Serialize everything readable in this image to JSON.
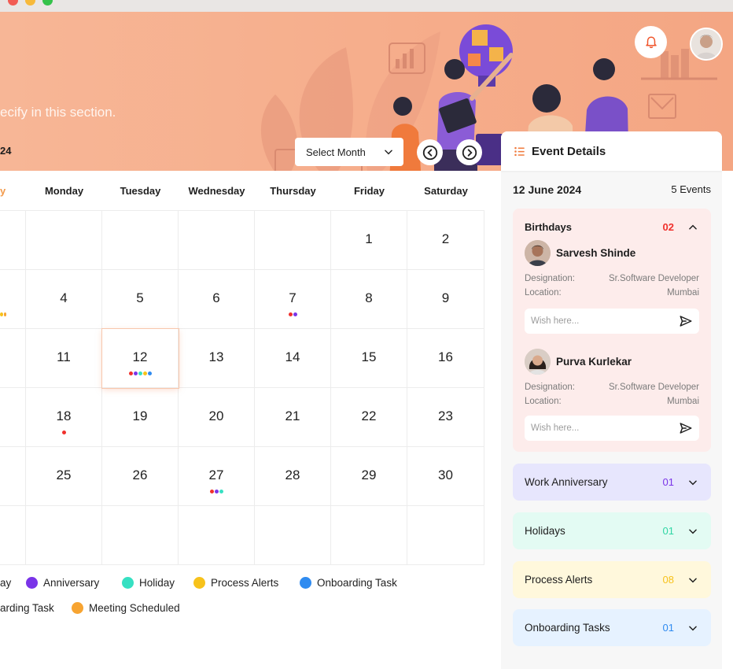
{
  "banner": {
    "subtitle": "ecify in this section.",
    "year_fragment": "24"
  },
  "toolbar": {
    "month_select_label": "Select Month"
  },
  "calendar": {
    "weekdays": [
      "y",
      "Monday",
      "Tuesday",
      "Wednesday",
      "Thursday",
      "Friday",
      "Saturday"
    ],
    "weekday_first_color": "#f29a4b",
    "rows": [
      [
        "",
        "",
        "",
        "",
        "",
        "1",
        "2"
      ],
      [
        "",
        "4",
        "5",
        "6",
        "7",
        "8",
        "9"
      ],
      [
        "",
        "11",
        "12",
        "13",
        "14",
        "15",
        "16"
      ],
      [
        "",
        "18",
        "19",
        "20",
        "21",
        "22",
        "23"
      ],
      [
        "",
        "25",
        "26",
        "27",
        "28",
        "29",
        "30"
      ],
      [
        "",
        "",
        "",
        "",
        "",
        "",
        ""
      ]
    ],
    "selected_day": "12",
    "event_dots": {
      "1-0": [
        "#f7c21b",
        "#f7a431"
      ],
      "1-4": [
        "#f0302c",
        "#7a34e8"
      ],
      "2-2": [
        "#f0302c",
        "#7a34e8",
        "#36e0c2",
        "#f7c21b",
        "#2f8bf0"
      ],
      "3-1": [
        "#f0302c"
      ],
      "4-3": [
        "#f0302c",
        "#7a34e8",
        "#36e0c2"
      ]
    }
  },
  "legend": {
    "row1": [
      {
        "label": "ay",
        "color": ""
      },
      {
        "label": "Anniversary",
        "color": "#7a34e8"
      },
      {
        "label": "Holiday",
        "color": "#36e0c2"
      },
      {
        "label": "Process Alerts",
        "color": "#f7c21b"
      },
      {
        "label": "Onboarding Task",
        "color": "#2f8bf0"
      }
    ],
    "row2": [
      {
        "label": "arding Task",
        "color": ""
      },
      {
        "label": "Meeting Scheduled",
        "color": "#f7a431"
      }
    ]
  },
  "event_panel": {
    "title": "Event Details",
    "date": "12 June 2024",
    "count": "5 Events",
    "birthdays": {
      "title": "Birthdays",
      "count": "02",
      "count_color": "#f0302c",
      "designation_label": "Designation:",
      "location_label": "Location:",
      "wish_placeholder": "Wish here...",
      "people": [
        {
          "name": "Sarvesh Shinde",
          "designation": "Sr.Software Developer",
          "location": "Mumbai"
        },
        {
          "name": "Purva Kurlekar",
          "designation": "Sr.Software Developer",
          "location": "Mumbai"
        }
      ]
    },
    "sections": [
      {
        "title": "Work Anniversary",
        "count": "01",
        "bg": "#e7e6fd",
        "count_color": "#7a34e8"
      },
      {
        "title": "Holidays",
        "count": "01",
        "bg": "#e3fbf3",
        "count_color": "#2fd6a4"
      },
      {
        "title": "Process Alerts",
        "count": "08",
        "bg": "#fff8dc",
        "count_color": "#f7c21b"
      },
      {
        "title": "Onboarding Tasks",
        "count": "01",
        "bg": "#e6f2ff",
        "count_color": "#2f8bf0"
      }
    ]
  }
}
